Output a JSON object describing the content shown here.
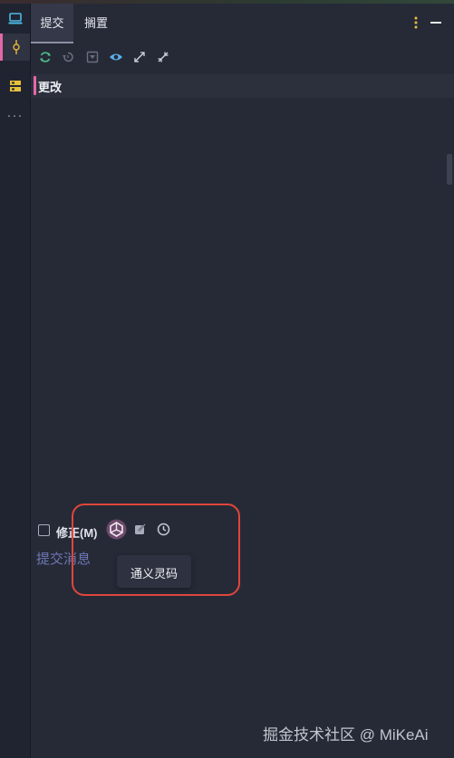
{
  "tabs": [
    {
      "label": "提交",
      "active": true
    },
    {
      "label": "搁置",
      "active": false
    }
  ],
  "header_actions": {
    "more_icon": "vertical-dots-icon",
    "minimize_icon": "minimize-icon"
  },
  "sidebar": {
    "items": [
      {
        "icon": "computer-icon"
      },
      {
        "icon": "commit-icon",
        "active": true
      },
      {
        "icon": "layers-icon"
      },
      {
        "icon": "more-dots-icon",
        "text": "···"
      }
    ]
  },
  "toolbar": {
    "icons": [
      "refresh-icon",
      "rollback-icon",
      "download-icon",
      "eye-icon",
      "expand-icon",
      "collapse-icon"
    ]
  },
  "changes": {
    "label": "更改"
  },
  "amend": {
    "label": "修正(M)",
    "checked": false
  },
  "commit_message": {
    "placeholder": "提交消息"
  },
  "tooltip": {
    "text": "通义灵码"
  },
  "watermark": {
    "text": "掘金技术社区 @ MiKeAi"
  },
  "colors": {
    "accent_pink": "#e567a7",
    "accent_green": "#4fc08d",
    "eye_blue": "#5ab3f0",
    "highlight_red": "#e0463a",
    "more_yellow": "#e7c13a"
  }
}
